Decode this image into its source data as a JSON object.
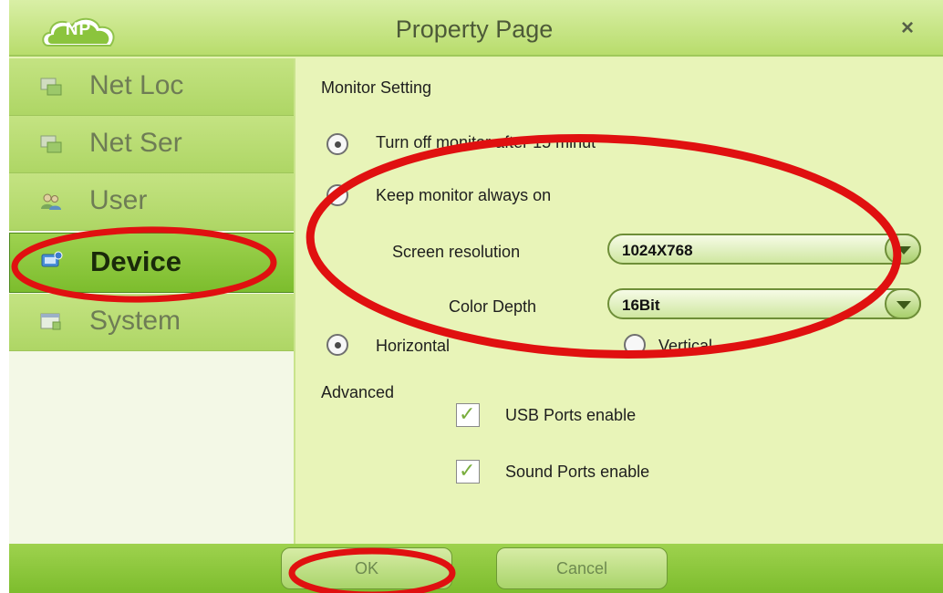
{
  "window": {
    "title": "Property Page",
    "logo_text": "NP",
    "close_glyph": "×"
  },
  "sidebar": {
    "items": [
      {
        "label": "Net Loc",
        "icon": "network-location-icon",
        "active": false
      },
      {
        "label": "Net Ser",
        "icon": "network-server-icon",
        "active": false
      },
      {
        "label": "User",
        "icon": "users-icon",
        "active": false
      },
      {
        "label": "Device",
        "icon": "device-icon",
        "active": true
      },
      {
        "label": "System",
        "icon": "system-icon",
        "active": false
      }
    ]
  },
  "monitor": {
    "section_label": "Monitor Setting",
    "turn_off_label": "Turn off monitor after 15 minut",
    "keep_on_label": "Keep monitor always on",
    "resolution_label": "Screen resolution",
    "resolution_value": "1024X768",
    "color_depth_label": "Color Depth",
    "color_depth_value": "16Bit",
    "horizontal_label": "Horizontal",
    "vertical_label": "Vertical"
  },
  "advanced": {
    "section_label": "Advanced",
    "usb_label": "USB Ports enable",
    "sound_label": "Sound Ports enable"
  },
  "footer": {
    "ok_label": "OK",
    "cancel_label": "Cancel"
  },
  "colors": {
    "accent": "#7cbd2d",
    "background": "#e6f3b5",
    "annotation": "#e01010"
  }
}
